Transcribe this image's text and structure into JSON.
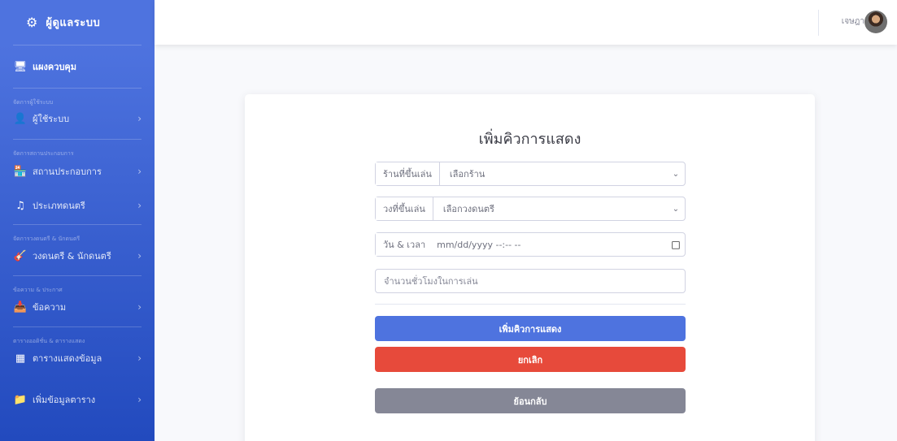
{
  "brand": {
    "icon": "cog-icon",
    "title": "ผู้ดูแลระบบ"
  },
  "sidebar": {
    "dashboard": {
      "icon": "monitor-icon",
      "label": "แผงควบคุม"
    },
    "sections": [
      {
        "heading": "จัดการผู้ใช้ระบบ",
        "items": [
          {
            "icon": "user-icon",
            "label": "ผู้ใช้ระบบ"
          }
        ]
      },
      {
        "heading": "จัดการสถานประกอบการ",
        "items": [
          {
            "icon": "store-icon",
            "label": "สถานประกอบการ"
          },
          {
            "icon": "music-icon",
            "label": "ประเภทดนตรี"
          }
        ]
      },
      {
        "heading": "จัดการวงดนตรี & นักดนตรี",
        "items": [
          {
            "icon": "guitar-icon",
            "label": "วงดนตรี & นักดนตรี"
          }
        ]
      },
      {
        "heading": "ข้อความ & ประกาศ",
        "items": [
          {
            "icon": "inbox-icon",
            "label": "ข้อความ"
          }
        ]
      },
      {
        "heading": "ตารางออดิชั่น & ตารางแสดง",
        "items": [
          {
            "icon": "table-icon",
            "label": "ตารางแสดงข้อมูล"
          },
          {
            "icon": "folder-plus-icon",
            "label": "เพิ่มข้อมูลตาราง"
          }
        ]
      }
    ]
  },
  "topbar": {
    "user_name": "เจษฎา"
  },
  "form": {
    "title": "เพิ่มคิวการแสดง",
    "venue": {
      "label": "ร้านที่ขึ้นเล่น",
      "value": "เลือกร้าน"
    },
    "band": {
      "label": "วงที่ขึ้นเล่น",
      "value": "เลือกวงดนตรี"
    },
    "datetime": {
      "label": "วัน & เวลา",
      "placeholder": "mm/dd/yyyy --:-- --"
    },
    "hours": {
      "placeholder": "จำนวนชั่วโมงในการเล่น"
    },
    "submit_label": "เพิ่มคิวการแสดง",
    "cancel_label": "ยกเลิก",
    "back_label": "ย้อนกลับ"
  },
  "colors": {
    "primary": "#4e73df",
    "danger": "#e74a3b",
    "secondary": "#858796"
  }
}
